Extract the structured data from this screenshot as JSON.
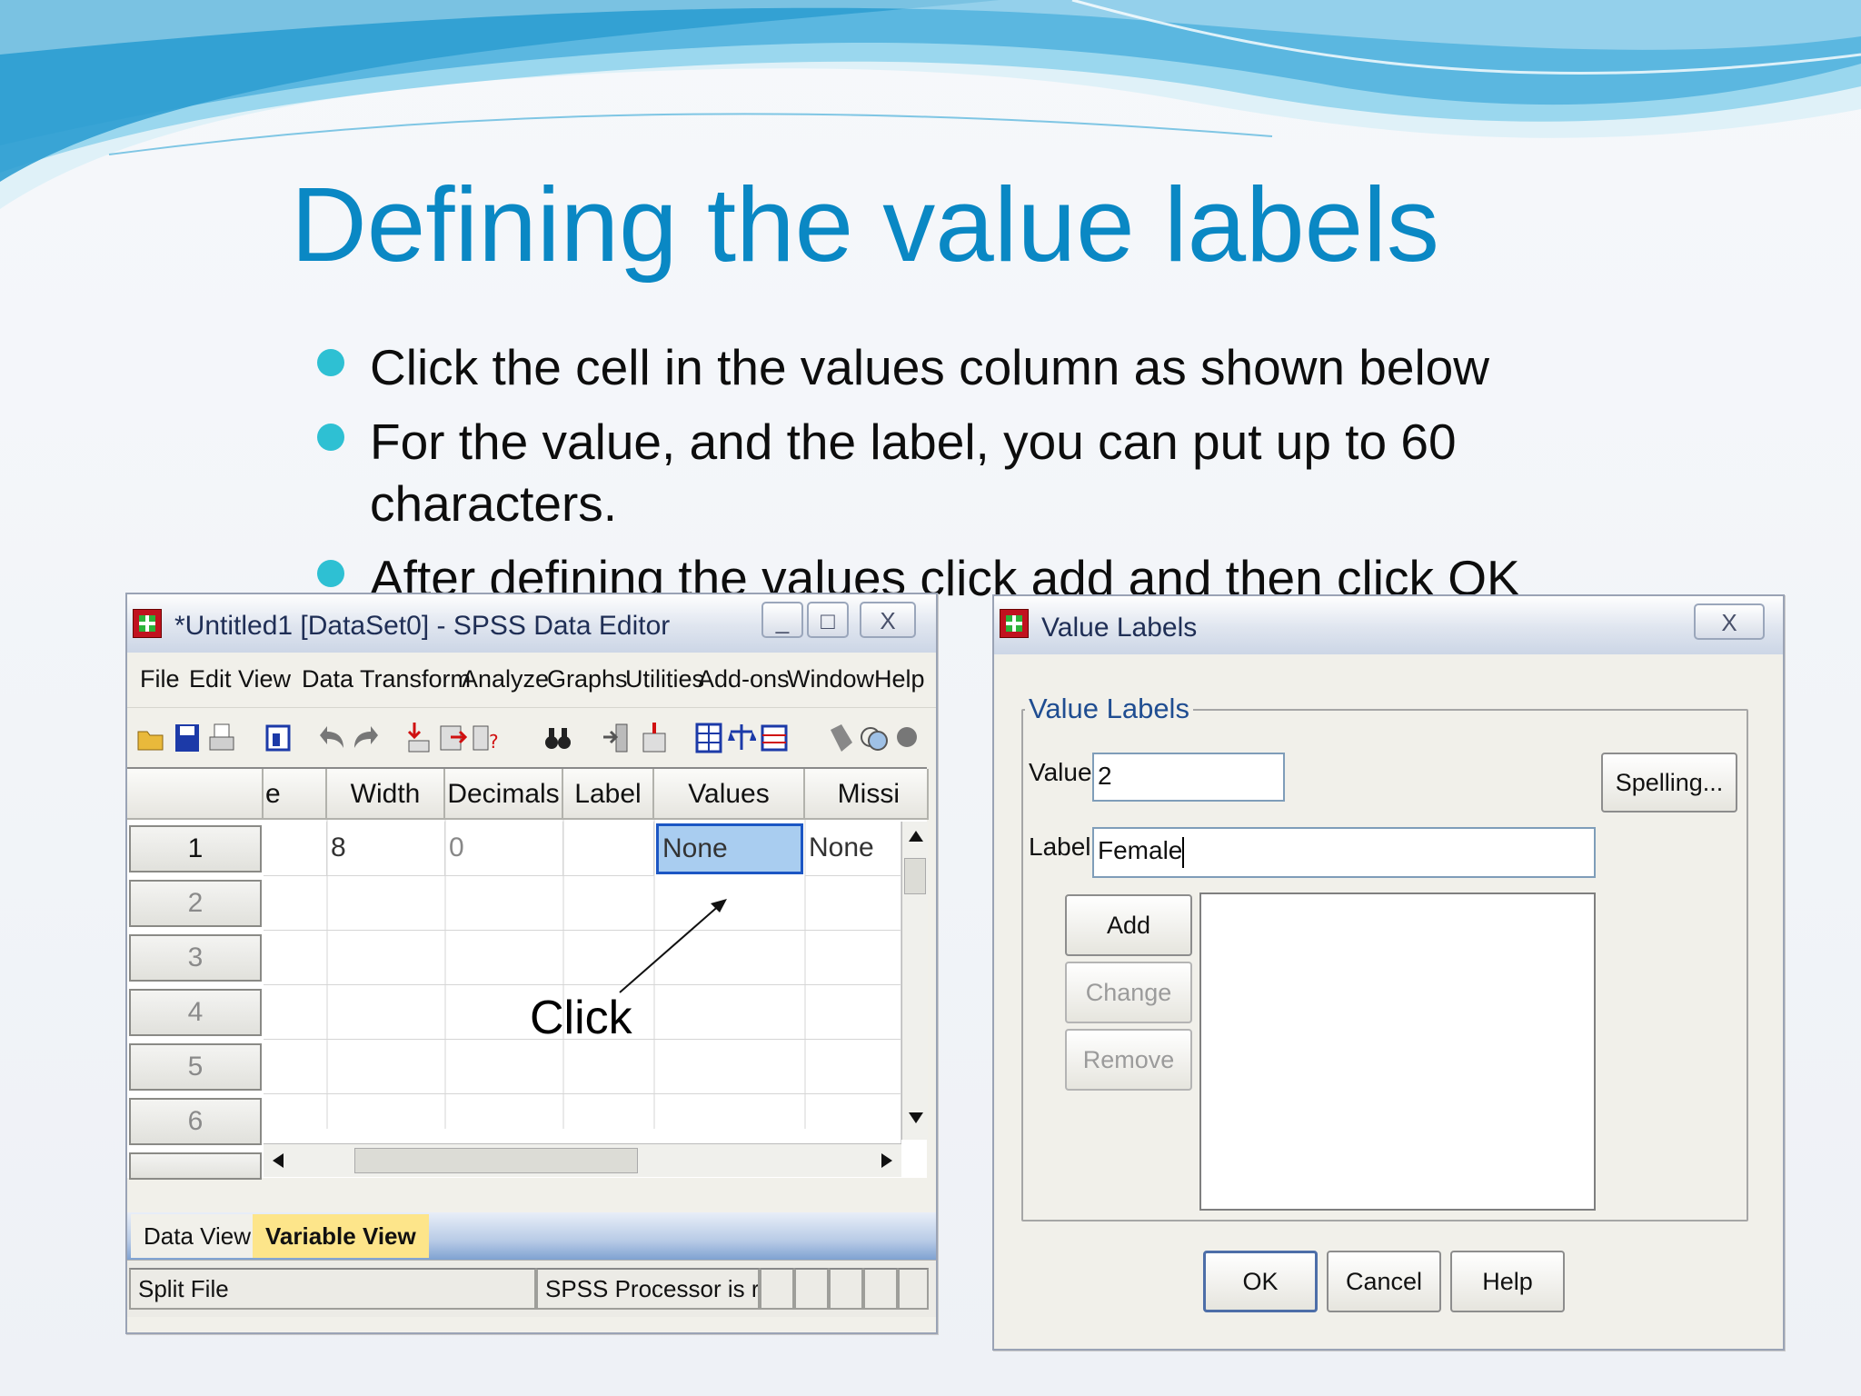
{
  "slide": {
    "title": "Defining the value labels",
    "bullets": [
      "Click the cell in the values column as shown below",
      "For the value, and the label, you can put up to 60 characters.",
      "After defining the values click add and then click OK"
    ],
    "annotation": "Click"
  },
  "spss_editor": {
    "title": "*Untitled1 [DataSet0] - SPSS Data Editor",
    "window_buttons": [
      "_",
      "□",
      "X"
    ],
    "menu": [
      "File",
      "Edit",
      "View",
      "Data",
      "Transform",
      "Analyze",
      "Graphs",
      "Utilities",
      "Add-ons",
      "Window",
      "Help"
    ],
    "toolbar_icons": [
      "open-folder-icon",
      "save-icon",
      "print-icon",
      "dialog-recall-icon",
      "undo-icon",
      "redo-icon",
      "goto-case-icon",
      "variables-icon",
      "find-icon",
      "binoculars-icon",
      "insert-cases-icon",
      "insert-variable-icon",
      "split-file-icon",
      "weight-cases-icon",
      "select-cases-icon",
      "value-labels-icon",
      "use-sets-icon",
      "show-all-icon"
    ],
    "grid": {
      "columns": [
        "e",
        "Width",
        "Decimals",
        "Label",
        "Values",
        "Missi"
      ],
      "rows": [
        {
          "num": "1",
          "cells": [
            "",
            "8",
            "0",
            "",
            "None",
            "None"
          ]
        },
        {
          "num": "2",
          "cells": [
            "",
            "",
            "",
            "",
            "",
            ""
          ]
        },
        {
          "num": "3",
          "cells": [
            "",
            "",
            "",
            "",
            "",
            ""
          ]
        },
        {
          "num": "4",
          "cells": [
            "",
            "",
            "",
            "",
            "",
            ""
          ]
        },
        {
          "num": "5",
          "cells": [
            "",
            "",
            "",
            "",
            "",
            ""
          ]
        },
        {
          "num": "6",
          "cells": [
            "",
            "",
            "",
            "",
            "",
            ""
          ]
        }
      ]
    },
    "tabs": [
      "Data View",
      "Variable View"
    ],
    "status": [
      "Split File",
      "SPSS  Processor is ready"
    ]
  },
  "value_labels_dialog": {
    "title": "Value Labels",
    "close": "X",
    "group_title": "Value Labels",
    "value_label": "Value:",
    "value": "2",
    "label_label": "Label:",
    "label_value": "Female",
    "spelling_button": "Spelling...",
    "add_button": "Add",
    "change_button": "Change",
    "remove_button": "Remove",
    "ok_button": "OK",
    "cancel_button": "Cancel",
    "help_button": "Help"
  }
}
